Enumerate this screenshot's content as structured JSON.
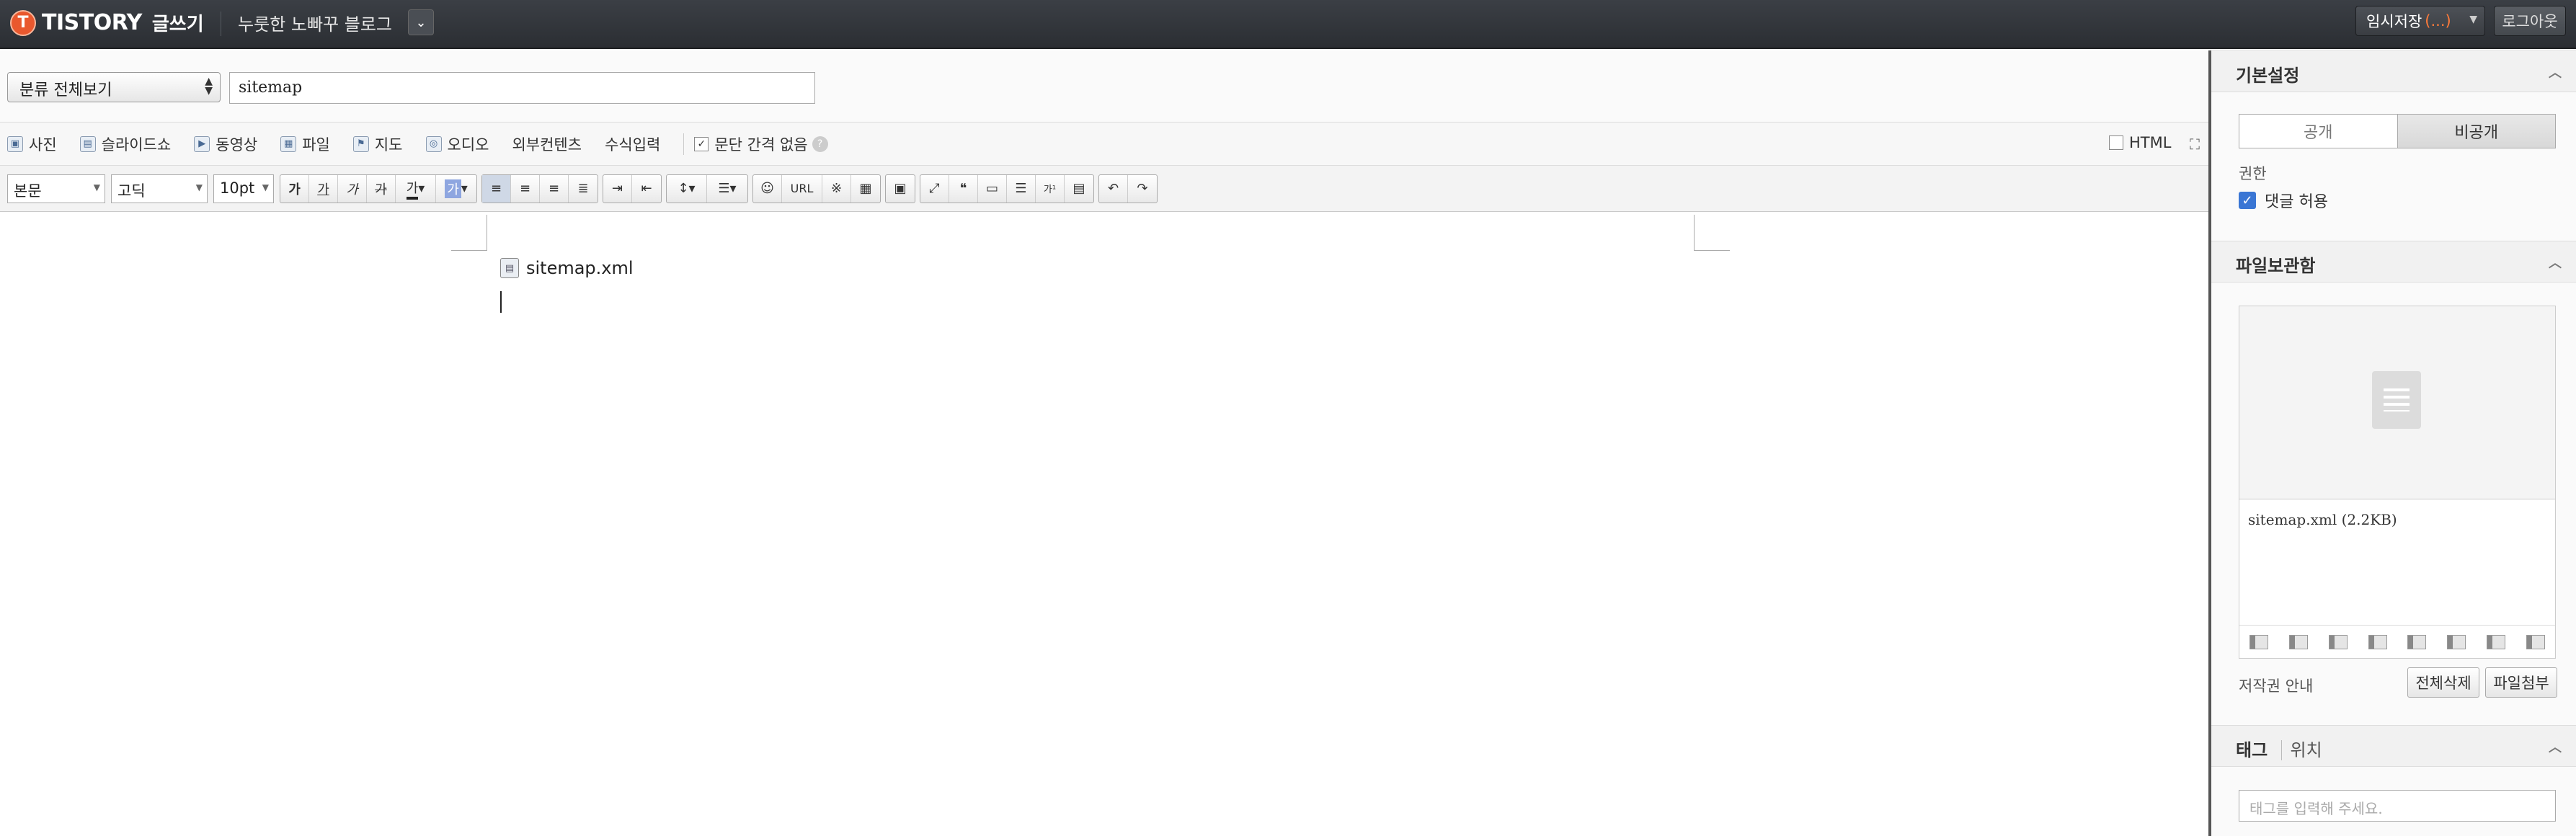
{
  "header": {
    "logo_letter": "T",
    "brand": "TISTORY",
    "mode": "글쓰기",
    "blog_name": "누룻한 노빠꾸 블로그",
    "temp_save_label": "임시저장",
    "temp_save_status": "(...)",
    "logout_label": "로그아웃"
  },
  "post": {
    "category": "분류 전체보기",
    "title": "sitemap",
    "attachment": "sitemap.xml"
  },
  "toolbar1": {
    "photo": "사진",
    "slideshow": "슬라이드쇼",
    "video": "동영상",
    "file": "파일",
    "map": "지도",
    "audio": "오디오",
    "external": "외부컨텐츠",
    "formula": "수식입력",
    "no_paragraph_spacing": "문단 간격 없음",
    "html_label": "HTML"
  },
  "toolbar2": {
    "style": "본문",
    "font": "고딕",
    "size": "10pt",
    "bold": "가",
    "italic": "가",
    "underline": "가",
    "strike": "가",
    "url": "URL"
  },
  "sidebar": {
    "basic_settings": "기본설정",
    "public": "공개",
    "private": "비공개",
    "permission": "권한",
    "allow_comments": "댓글 허용",
    "file_storage": "파일보관함",
    "file_entry": "sitemap.xml (2.2KB)",
    "copyright": "저작권 안내",
    "delete_all": "전체삭제",
    "attach_file": "파일첨부",
    "tag": "태그",
    "location": "위치",
    "tag_placeholder": "태그를 입력해 주세요."
  },
  "colors": {
    "accent": "#e9582e",
    "checkbox": "#3a76d4",
    "topbar": "#33373c"
  }
}
